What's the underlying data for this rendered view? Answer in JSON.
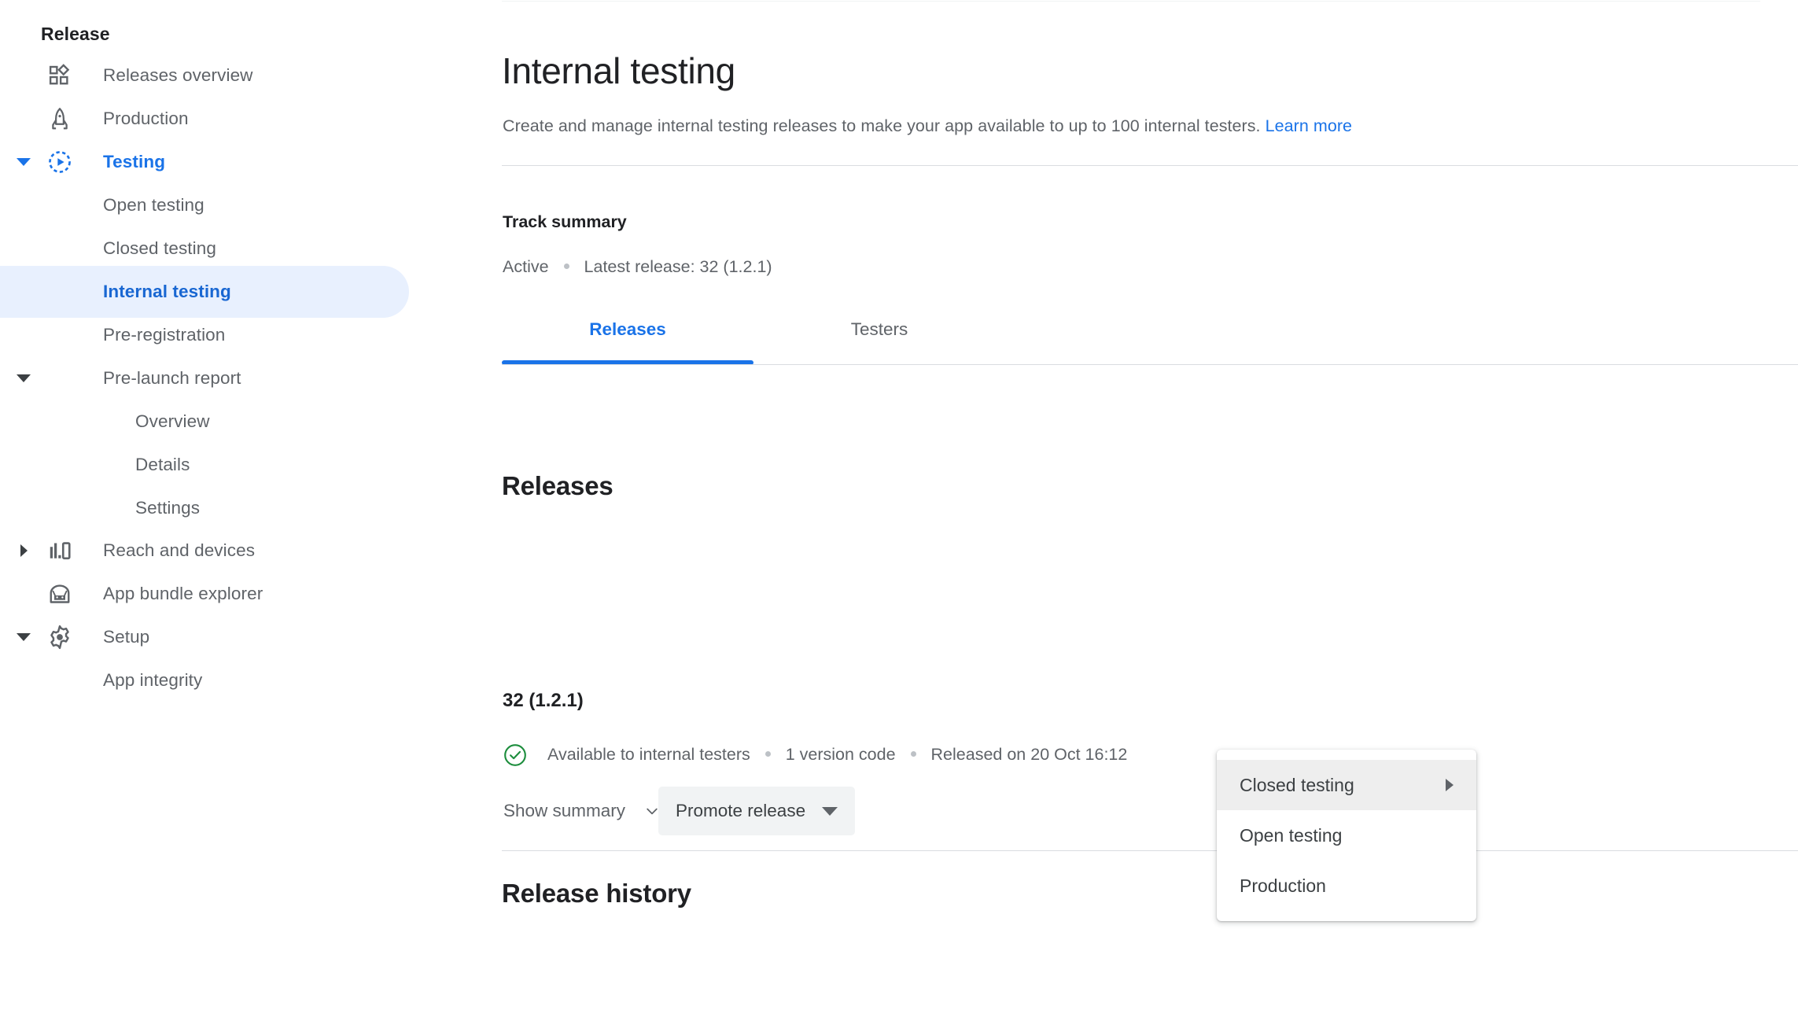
{
  "sidebar": {
    "section_title": "Release",
    "items": [
      {
        "label": "Releases overview",
        "icon": "grid-apps-icon",
        "level": 0,
        "expander": "none",
        "state": "normal"
      },
      {
        "label": "Production",
        "icon": "rocket-icon",
        "level": 0,
        "expander": "none",
        "state": "normal"
      },
      {
        "label": "Testing",
        "icon": "testing-target-icon",
        "level": 0,
        "expander": "expanded",
        "state": "current-section"
      },
      {
        "label": "Open testing",
        "icon": "",
        "level": 1,
        "expander": "none",
        "state": "normal"
      },
      {
        "label": "Closed testing",
        "icon": "",
        "level": 1,
        "expander": "none",
        "state": "normal"
      },
      {
        "label": "Internal testing",
        "icon": "",
        "level": 1,
        "expander": "none",
        "state": "selected"
      },
      {
        "label": "Pre-registration",
        "icon": "",
        "level": 1,
        "expander": "none",
        "state": "normal"
      },
      {
        "label": "Pre-launch report",
        "icon": "",
        "level": 1,
        "expander": "expanded",
        "state": "normal"
      },
      {
        "label": "Overview",
        "icon": "",
        "level": 2,
        "expander": "none",
        "state": "normal"
      },
      {
        "label": "Details",
        "icon": "",
        "level": 2,
        "expander": "none",
        "state": "normal"
      },
      {
        "label": "Settings",
        "icon": "",
        "level": 2,
        "expander": "none",
        "state": "normal"
      },
      {
        "label": "Reach and devices",
        "icon": "bar-chart-device-icon",
        "level": 0,
        "expander": "collapsed",
        "state": "normal"
      },
      {
        "label": "App bundle explorer",
        "icon": "android-bundle-icon",
        "level": 0,
        "expander": "none",
        "state": "normal"
      },
      {
        "label": "Setup",
        "icon": "gear-icon",
        "level": 0,
        "expander": "expanded",
        "state": "normal"
      },
      {
        "label": "App integrity",
        "icon": "",
        "level": 1,
        "expander": "none",
        "state": "normal"
      }
    ]
  },
  "main": {
    "title": "Internal testing",
    "description_text": "Create and manage internal testing releases to make your app available to up to 100 internal testers.",
    "learn_more_label": "Learn more",
    "track_summary": {
      "heading": "Track summary",
      "status": "Active",
      "latest_release": "Latest release: 32 (1.2.1)"
    },
    "tabs": [
      {
        "label": "Releases",
        "selected": true
      },
      {
        "label": "Testers",
        "selected": false
      }
    ],
    "releases_heading": "Releases",
    "release": {
      "name": "32 (1.2.1)",
      "status_icon": "check-circle-icon",
      "availability": "Available to internal testers",
      "version_codes": "1 version code",
      "released_on": "Released on 20 Oct 16:12",
      "show_summary_label": "Show summary",
      "promote_release_label": "Promote release"
    },
    "release_history_heading": "Release history",
    "promote_menu": {
      "items": [
        {
          "label": "Closed testing",
          "has_submenu": true,
          "highlighted": true
        },
        {
          "label": "Open testing",
          "has_submenu": false,
          "highlighted": false
        },
        {
          "label": "Production",
          "has_submenu": false,
          "highlighted": false
        }
      ]
    }
  },
  "colors": {
    "accent_blue": "#1a73e8",
    "selected_bg": "#e8f0fe",
    "text_primary": "#202124",
    "text_secondary": "#5f6368",
    "divider": "#dadce0",
    "success_green": "#1e8e3e",
    "button_bg": "#f1f3f4",
    "menu_highlight": "#eeeeee"
  }
}
